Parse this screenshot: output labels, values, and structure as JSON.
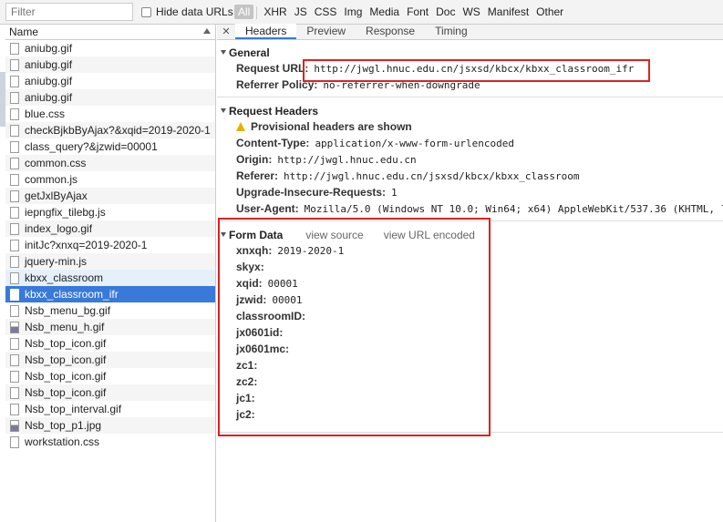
{
  "toolbar": {
    "filter_placeholder": "Filter",
    "hide_data_urls": "Hide data URLs",
    "types": [
      "All",
      "XHR",
      "JS",
      "CSS",
      "Img",
      "Media",
      "Font",
      "Doc",
      "WS",
      "Manifest",
      "Other"
    ]
  },
  "list": {
    "header": "Name",
    "files": [
      {
        "name": "aniubg.gif",
        "icon": "file-icon"
      },
      {
        "name": "aniubg.gif",
        "icon": "file-icon"
      },
      {
        "name": "aniubg.gif",
        "icon": "file-icon"
      },
      {
        "name": "aniubg.gif",
        "icon": "file-icon"
      },
      {
        "name": "blue.css",
        "icon": "file-icon"
      },
      {
        "name": "checkBjkbByAjax?&xqid=2019-2020-1",
        "icon": "file-icon"
      },
      {
        "name": "class_query?&jzwid=00001",
        "icon": "file-icon"
      },
      {
        "name": "common.css",
        "icon": "file-icon"
      },
      {
        "name": "common.js",
        "icon": "file-icon"
      },
      {
        "name": "getJxlByAjax",
        "icon": "file-icon"
      },
      {
        "name": "iepngfix_tilebg.js",
        "icon": "file-icon"
      },
      {
        "name": "index_logo.gif",
        "icon": "file-icon"
      },
      {
        "name": "initJc?xnxq=2019-2020-1",
        "icon": "file-icon"
      },
      {
        "name": "jquery-min.js",
        "icon": "file-icon"
      },
      {
        "name": "kbxx_classroom",
        "icon": "file-icon"
      },
      {
        "name": "kbxx_classroom_ifr",
        "icon": "file-icon"
      },
      {
        "name": "Nsb_menu_bg.gif",
        "icon": "file-icon"
      },
      {
        "name": "Nsb_menu_h.gif",
        "icon": "image-icon"
      },
      {
        "name": "Nsb_top_icon.gif",
        "icon": "file-icon"
      },
      {
        "name": "Nsb_top_icon.gif",
        "icon": "file-icon"
      },
      {
        "name": "Nsb_top_icon.gif",
        "icon": "file-icon"
      },
      {
        "name": "Nsb_top_icon.gif",
        "icon": "file-icon"
      },
      {
        "name": "Nsb_top_interval.gif",
        "icon": "file-icon"
      },
      {
        "name": "Nsb_top_p1.jpg",
        "icon": "image-icon"
      },
      {
        "name": "workstation.css",
        "icon": "file-icon"
      }
    ]
  },
  "tabs": [
    "Headers",
    "Preview",
    "Response",
    "Timing"
  ],
  "general": {
    "title": "General",
    "request_url_label": "Request URL:",
    "request_url": "http://jwgl.hnuc.edu.cn/jsxsd/kbcx/kbxx_classroom_ifr",
    "referrer_policy_label": "Referrer Policy:",
    "referrer_policy": "no-referrer-when-downgrade"
  },
  "request_headers": {
    "title": "Request Headers",
    "warning": "Provisional headers are shown",
    "items": [
      {
        "key": "Content-Type:",
        "value": "application/x-www-form-urlencoded"
      },
      {
        "key": "Origin:",
        "value": "http://jwgl.hnuc.edu.cn"
      },
      {
        "key": "Referer:",
        "value": "http://jwgl.hnuc.edu.cn/jsxsd/kbcx/kbxx_classroom"
      },
      {
        "key": "Upgrade-Insecure-Requests:",
        "value": "1"
      },
      {
        "key": "User-Agent:",
        "value": "Mozilla/5.0 (Windows NT 10.0; Win64; x64) AppleWebKit/537.36 (KHTML, l"
      }
    ]
  },
  "form_data": {
    "title": "Form Data",
    "view_source": "view source",
    "view_url_encoded": "view URL encoded",
    "items": [
      {
        "key": "xnxqh:",
        "value": "2019-2020-1"
      },
      {
        "key": "skyx:",
        "value": ""
      },
      {
        "key": "xqid:",
        "value": "00001"
      },
      {
        "key": "jzwid:",
        "value": "00001"
      },
      {
        "key": "classroomID:",
        "value": ""
      },
      {
        "key": "jx0601id:",
        "value": ""
      },
      {
        "key": "jx0601mc:",
        "value": ""
      },
      {
        "key": "zc1:",
        "value": ""
      },
      {
        "key": "zc2:",
        "value": ""
      },
      {
        "key": "jc1:",
        "value": ""
      },
      {
        "key": "jc2:",
        "value": ""
      }
    ]
  },
  "colors": {
    "selected": "#3879d9",
    "highlight_box": "#e02020",
    "warning": "#e6b000"
  }
}
